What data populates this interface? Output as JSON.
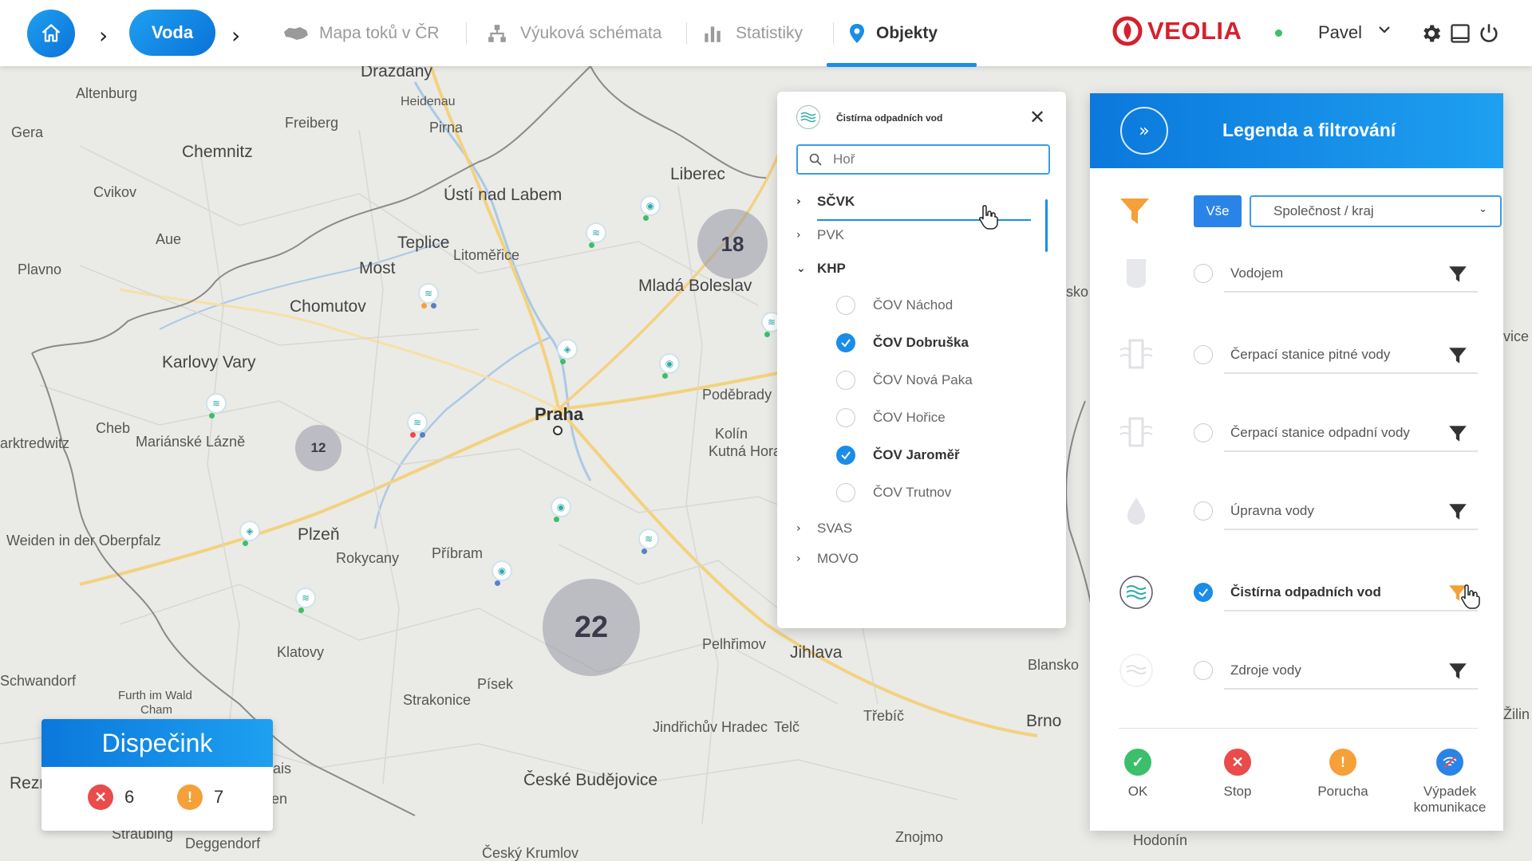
{
  "topbar": {
    "breadcrumb_current": "Voda",
    "nav": [
      {
        "label": "Mapa toků v ČR"
      },
      {
        "label": "Výuková schémata"
      },
      {
        "label": "Statistiky"
      },
      {
        "label": "Objekty"
      }
    ],
    "brand": "VEOLIA",
    "user": "Pavel"
  },
  "map": {
    "cities": [
      "Drazdany",
      "Altenburg",
      "Heidenau",
      "Pirna",
      "Gera",
      "Freiberg",
      "Chemnitz",
      "Cvikov",
      "Aue",
      "Ústí nad Labem",
      "Teplice",
      "Liberec",
      "Litoměřice",
      "Most",
      "Plavno",
      "Chomutov",
      "Mladá Boleslav",
      "Karlovy Vary",
      "Poděbrady",
      "Praha",
      "Cheb",
      "Mariánské Lázně",
      "Kolín",
      "Kutná Hora",
      "arktredwitz",
      "Weiden in der Oberpfalz",
      "Plzeň",
      "Rokycany",
      "Příbram",
      "Klatovy",
      "Pelhřimov",
      "Jihlava",
      "Blansko",
      "Schwandorf",
      "Furth im Wald",
      "Cham",
      "Strakonice",
      "Písek",
      "Jindřichův Hradec",
      "Telč",
      "Třebíč",
      "Brno",
      "Rezr",
      "Straubing",
      "Deggendorf",
      "České Budějovice",
      "Znojmo",
      "Hodonín",
      "Český Krumlov",
      "sko",
      "vice",
      "Žilin",
      "ais",
      "en"
    ],
    "clusters": [
      "18",
      "12",
      "22"
    ]
  },
  "popup": {
    "title": "Čistírna odpadních vod",
    "search_value": "Hoř",
    "groups": [
      {
        "label": "SČVK"
      },
      {
        "label": "PVK"
      },
      {
        "label": "KHP"
      },
      {
        "label": "SVAS"
      },
      {
        "label": "MOVO"
      }
    ],
    "khp_items": [
      {
        "label": "ČOV Náchod",
        "checked": false
      },
      {
        "label": "ČOV Dobruška",
        "checked": true
      },
      {
        "label": "ČOV Nová Paka",
        "checked": false
      },
      {
        "label": "ČOV Hořice",
        "checked": false
      },
      {
        "label": "ČOV Jaroměř",
        "checked": true
      },
      {
        "label": "ČOV Trutnov",
        "checked": false
      }
    ]
  },
  "legend": {
    "title": "Legenda a filtrování",
    "all_button": "Vše",
    "select_value": "Společnost / kraj",
    "items": [
      {
        "label": "Vodojem",
        "checked": false
      },
      {
        "label": "Čerpací stanice pitné vody",
        "checked": false
      },
      {
        "label": "Čerpací stanice odpadní vody",
        "checked": false
      },
      {
        "label": "Úpravna vody",
        "checked": false
      },
      {
        "label": "Čistírna odpadních vod",
        "checked": true
      },
      {
        "label": "Zdroje vody",
        "checked": false
      }
    ],
    "statuses": [
      {
        "label": "OK"
      },
      {
        "label": "Stop"
      },
      {
        "label": "Porucha"
      },
      {
        "label": "Výpadek komunikace"
      }
    ]
  },
  "dispecink": {
    "title": "Dispečink",
    "stop_count": "6",
    "warning_count": "7"
  },
  "colors": {
    "accent": "#1a8de8",
    "brand_red": "#d6202d",
    "ok": "#3cbf6a",
    "stop": "#ea4b4b",
    "warning": "#f5a038",
    "filter_orange": "#f5a038"
  }
}
